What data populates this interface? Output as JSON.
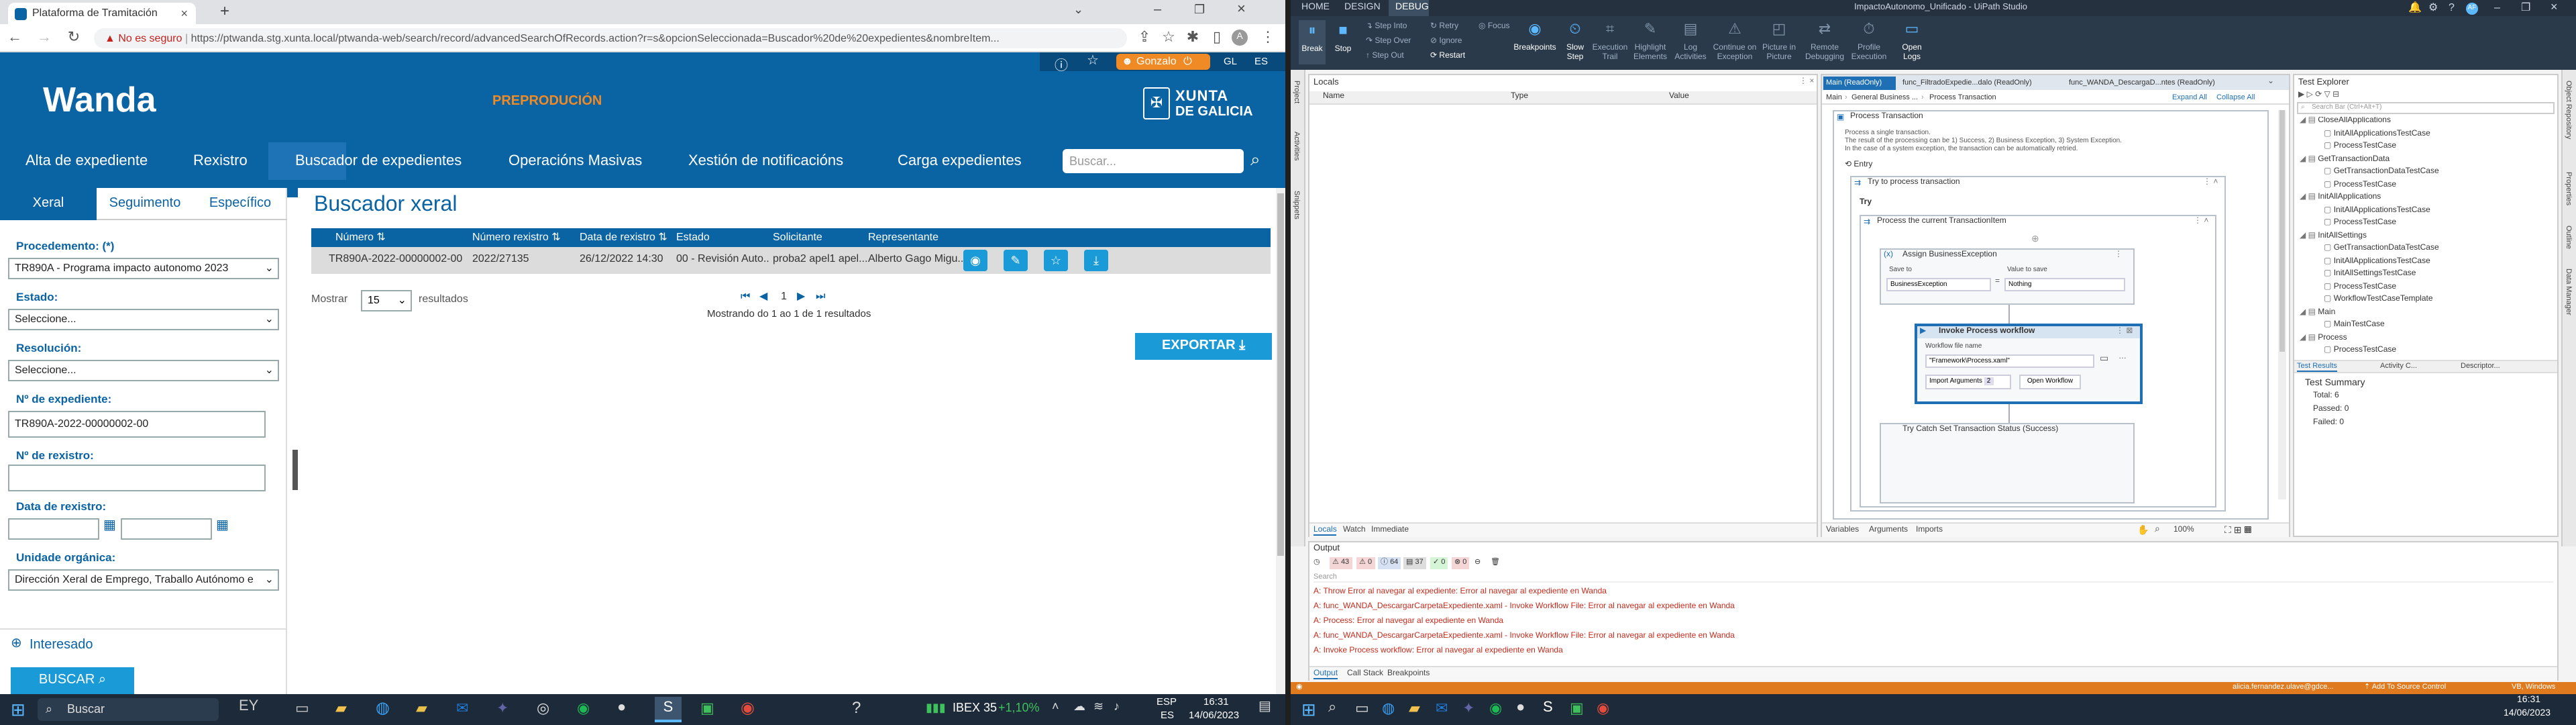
{
  "browser": {
    "tab_title": "Plataforma de Tramitación",
    "new_tab": "+",
    "insecure_label": "No es seguro",
    "url": "https://ptwanda.stg.xunta.local/ptwanda-web/search/record/advancedSearchOfRecords.action?r=s&opcionSeleccionada=Buscador%20de%20expedientes&nombreItem...",
    "profile_letter": "A"
  },
  "wanda": {
    "logo": "Wanda",
    "env_label": "PREPRODUCIÓN",
    "user_name": "Gonzalo",
    "lang_gl": "GL",
    "lang_es": "ES",
    "brand_line1": "XUNTA",
    "brand_line2": "DE GALICIA",
    "nav": [
      "Alta de expediente",
      "Rexistro",
      "Buscador de expedientes",
      "Operacións Masivas",
      "Xestión de notificacións",
      "Carga expedientes"
    ],
    "search_placeholder": "Buscar..."
  },
  "sidebar": {
    "tabs": [
      "Xeral",
      "Seguimento",
      "Específico"
    ],
    "procedemento_label": "Procedemento: (*)",
    "procedemento_value": "TR890A - Programa impacto autonomo 2023",
    "estado_label": "Estado:",
    "estado_value": "Seleccione...",
    "resolucion_label": "Resolución:",
    "resolucion_value": "Seleccione...",
    "expediente_label": "Nº de expediente:",
    "expediente_value": "TR890A-2022-00000002-00",
    "rexistro_label": "Nº de rexistro:",
    "data_label": "Data de rexistro:",
    "unidade_label": "Unidade orgánica:",
    "unidade_value": "Dirección Xeral de Emprego, Traballo Autónomo e",
    "interesado_label": "Interesado",
    "buscar_button": "BUSCAR"
  },
  "results": {
    "title": "Buscador xeral",
    "headers": [
      "Número",
      "Número rexistro",
      "Data de rexistro",
      "Estado",
      "Solicitante",
      "Representante"
    ],
    "row": {
      "numero": "TR890A-2022-00000002-00",
      "rexistro": "2022/27135",
      "data": "26/12/2022 14:30",
      "estado": "00 - Revisión Auto...",
      "solicitante": "proba2 apel1 apel...",
      "representante": "Alberto Gago Migu..."
    },
    "mostrar_label": "Mostrar",
    "page_size": "15",
    "resultados_label": "resultados",
    "page_number": "1",
    "showing": "Mostrando do 1 ao 1 de 1 resultados",
    "export_button": "EXPORTAR"
  },
  "studio": {
    "window_title": "ImpactoAutonomo_Unificado - UiPath Studio",
    "ribbon_tabs": [
      "HOME",
      "DESIGN",
      "DEBUG"
    ],
    "ribbon_buttons": [
      "Break",
      "Stop",
      "Step Into",
      "Step Over",
      "Step Out",
      "Retry",
      "Ignore",
      "Restart",
      "Focus",
      "Breakpoints",
      "Slow Step",
      "Execution Trail",
      "Highlight Elements",
      "Log Activities",
      "Continue on Exception",
      "Picture in Picture",
      "Remote Debugging",
      "Profile Execution",
      "Open Logs"
    ],
    "locals_title": "Locals",
    "locals_cols": [
      "Name",
      "Type",
      "Value"
    ],
    "locals_tabs": [
      "Locals",
      "Watch",
      "Immediate"
    ],
    "doc_tabs": [
      "Main (ReadOnly)",
      "func_FiltradoExpedie...dalo (ReadOnly)",
      "func_WANDA_DescargaD...ntes (ReadOnly)"
    ],
    "breadcrumb": [
      "Main",
      "General Business ...",
      "Process Transaction"
    ],
    "expand_all": "Expand All",
    "collapse_all": "Collapse All",
    "process_title": "Process Transaction",
    "process_desc": [
      "Process a single transaction.",
      "The result of the processing can be 1) Success, 2) Business Exception, 3) System Exception.",
      "In the case of a system exception, the transaction can be automatically retried."
    ],
    "entry": "Entry",
    "try_process": "Try to process transaction",
    "try": "Try",
    "process_item": "Process the current TransactionItem",
    "assign_title": "Assign BusinessException",
    "save_to": "Save to",
    "value_to_save": "Value to save",
    "assign_left": "BusinessException",
    "assign_right": "Nothing",
    "invoke_title": "Invoke Process workflow",
    "workflow_file_name": "Workflow file name",
    "workflow_file": "\"Framework\\Process.xaml\"",
    "import_arguments": "Import Arguments",
    "import_count": "2",
    "open_workflow": "Open Workflow",
    "try_catch": "Try Catch Set Transaction Status (Success)",
    "bottom_tabs": [
      "Variables",
      "Arguments",
      "Imports"
    ],
    "zoom": "100%",
    "test_explorer": "Test Explorer",
    "test_search": "Search Bar (Ctrl+Alt+T)",
    "test_tree": [
      {
        "text": "CloseAllApplications",
        "level": 0
      },
      {
        "text": "InitAllApplicationsTestCase",
        "level": 1
      },
      {
        "text": "ProcessTestCase",
        "level": 1
      },
      {
        "text": "GetTransactionData",
        "level": 0
      },
      {
        "text": "GetTransactionDataTestCase",
        "level": 1
      },
      {
        "text": "ProcessTestCase",
        "level": 1
      },
      {
        "text": "InitAllApplications",
        "level": 0
      },
      {
        "text": "InitAllApplicationsTestCase",
        "level": 1
      },
      {
        "text": "ProcessTestCase",
        "level": 1
      },
      {
        "text": "InitAllSettings",
        "level": 0
      },
      {
        "text": "GetTransactionDataTestCase",
        "level": 1
      },
      {
        "text": "InitAllApplicationsTestCase",
        "level": 1
      },
      {
        "text": "InitAllSettingsTestCase",
        "level": 1
      },
      {
        "text": "ProcessTestCase",
        "level": 1
      },
      {
        "text": "WorkflowTestCaseTemplate",
        "level": 1
      },
      {
        "text": "Main",
        "level": 0
      },
      {
        "text": "MainTestCase",
        "level": 1
      },
      {
        "text": "Process",
        "level": 0
      },
      {
        "text": "ProcessTestCase",
        "level": 1
      }
    ],
    "test_tabs": [
      "Test Results",
      "Activity C...",
      "Descriptor..."
    ],
    "test_summary": "Test Summary",
    "total": "Total: 6",
    "passed": "Passed: 0",
    "failed": "Failed: 0",
    "output_title": "Output",
    "output_counts": [
      "43",
      "0",
      "64",
      "37",
      "0",
      "0"
    ],
    "output_search": "Search",
    "output_lines": [
      "A: Throw Error al navegar al expediente: Error al navegar al expediente en Wanda",
      "A: func_WANDA_DescargarCarpetaExpediente.xaml - Invoke Workflow File: Error al navegar al expediente en Wanda",
      "A: Process: Error al navegar al expediente en Wanda",
      "A: func_WANDA_DescargarCarpetaExpediente.xaml - Invoke Workflow File: Error al navegar al expediente en Wanda",
      "A: Invoke Process workflow: Error al navegar al expediente en Wanda"
    ],
    "output_tabs": [
      "Output",
      "Call Stack",
      "Breakpoints"
    ],
    "status_user": "alicia.fernandez.ulave@gdce...",
    "status_source": "Add To Source Control",
    "status_vb": "VB, Windows",
    "side_tabs_left": [
      "Project",
      "Activities",
      "Snippets"
    ],
    "side_tabs_right": [
      "Object Repository",
      "Properties",
      "Outline",
      "Data Manager"
    ]
  },
  "taskbar_left": {
    "search_label": "Buscar",
    "ticker_name": "IBEX 35",
    "ticker_change": "+1,10%",
    "lang": "ESP",
    "lang2": "ES",
    "time": "16:31",
    "date": "14/06/2023"
  },
  "taskbar_right": {
    "time": "16:31",
    "date": "14/06/2023"
  },
  "colors": {
    "wanda_blue": "#0a63a3",
    "accent_orange": "#f08a24",
    "studio_dark": "#2b3a4b",
    "error_red": "#c42b1c"
  }
}
